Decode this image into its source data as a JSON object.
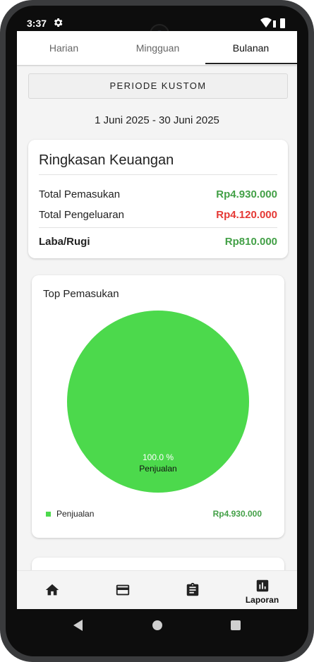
{
  "status_bar": {
    "time": "3:37",
    "icons": [
      "gear-icon",
      "wifi-icon",
      "battery-icon"
    ]
  },
  "tabs": [
    {
      "label": "Harian",
      "active": false
    },
    {
      "label": "Mingguan",
      "active": false
    },
    {
      "label": "Bulanan",
      "active": true
    }
  ],
  "period": {
    "button_label": "PERIODE KUSTOM",
    "date_range": "1 Juni 2025 - 30 Juni 2025"
  },
  "summary": {
    "title": "Ringkasan Keuangan",
    "income_label": "Total Pemasukan",
    "income_value": "Rp4.930.000",
    "expense_label": "Total Pengeluaran",
    "expense_value": "Rp4.120.000",
    "profit_label": "Laba/Rugi",
    "profit_value": "Rp810.000"
  },
  "top_income": {
    "title": "Top Pemasukan",
    "slice_percent_label": "100.0 %",
    "slice_name_label": "Penjualan",
    "legend": [
      {
        "label": "Penjualan",
        "value": "Rp4.930.000"
      }
    ]
  },
  "chart_data": {
    "type": "pie",
    "title": "Top Pemasukan",
    "categories": [
      "Penjualan"
    ],
    "values": [
      100.0
    ],
    "colors": [
      "#4cd94c"
    ]
  },
  "bottom_nav": [
    {
      "icon": "home-icon",
      "label": ""
    },
    {
      "icon": "credit-card-icon",
      "label": ""
    },
    {
      "icon": "clipboard-icon",
      "label": ""
    },
    {
      "icon": "bar-chart-icon",
      "label": "Laporan"
    }
  ],
  "colors": {
    "income": "#43a047",
    "expense": "#e53935",
    "pie": "#4cd94c"
  }
}
